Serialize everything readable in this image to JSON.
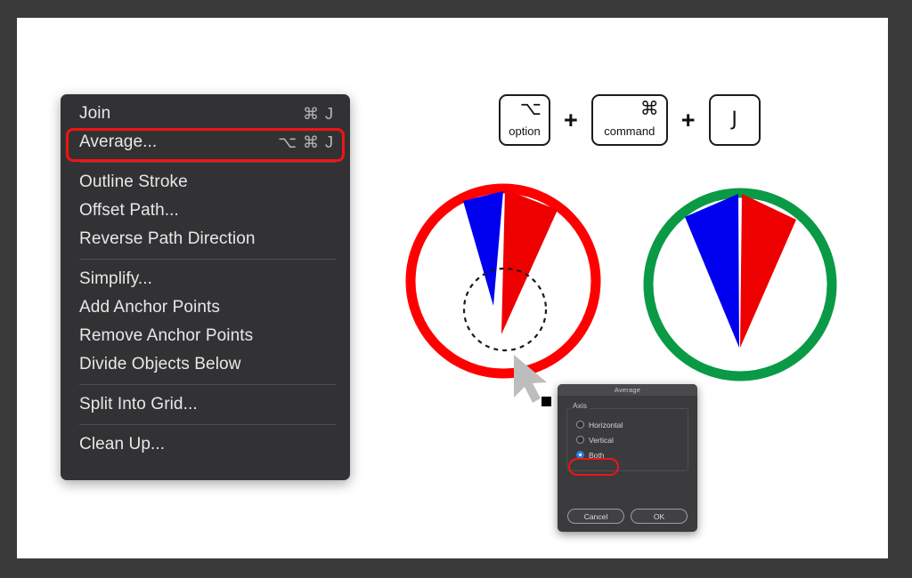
{
  "app": {
    "title": "Illustrator Average Path Tip",
    "canvas_background": "#ffffff",
    "frame_color": "#3a3a3a"
  },
  "context_menu": {
    "name": "Path context menu",
    "background": "#323234",
    "highlighted_item": "Average...",
    "highlight_color": "#f01414",
    "items": [
      {
        "label": "Join",
        "shortcut": "⌘ J",
        "highlighted": false
      },
      {
        "label": "Average...",
        "shortcut": "⌥ ⌘ J",
        "highlighted": true
      },
      {
        "label": "Outline Stroke",
        "shortcut": "",
        "highlighted": false
      },
      {
        "label": "Offset Path...",
        "shortcut": "",
        "highlighted": false
      },
      {
        "label": "Reverse Path Direction",
        "shortcut": "",
        "highlighted": false
      },
      {
        "label": "Simplify...",
        "shortcut": "",
        "highlighted": false
      },
      {
        "label": "Add Anchor Points",
        "shortcut": "",
        "highlighted": false
      },
      {
        "label": "Remove Anchor Points",
        "shortcut": "",
        "highlighted": false
      },
      {
        "label": "Divide Objects Below",
        "shortcut": "",
        "highlighted": false
      },
      {
        "label": "Split Into Grid...",
        "shortcut": "",
        "highlighted": false
      },
      {
        "label": "Clean Up...",
        "shortcut": "",
        "highlighted": false
      }
    ]
  },
  "shortcut_keys": {
    "separator": "+",
    "keys": [
      {
        "glyph": "⌥",
        "name": "option"
      },
      {
        "glyph": "⌘",
        "name": "command"
      },
      {
        "glyph": "J",
        "name": ""
      }
    ]
  },
  "artwork": {
    "before": {
      "caption": "",
      "circle_stroke_color": "#ff0000",
      "wedges": [
        {
          "color": "#0000ee",
          "label": "blue-wedge"
        },
        {
          "color": "#ee0000",
          "label": "red-wedge"
        }
      ],
      "selection_marquee": "dashed-circle",
      "cursor": "arrow-cursor",
      "anchor_point": "black-square"
    },
    "after": {
      "caption": "",
      "circle_stroke_color": "#0a9a46",
      "wedges": [
        {
          "color": "#0000ee",
          "label": "blue-wedge"
        },
        {
          "color": "#ee0000",
          "label": "red-wedge"
        }
      ]
    }
  },
  "dialog": {
    "title": "Average",
    "group_label": "Axis",
    "options": [
      {
        "label": "Horizontal",
        "selected": false
      },
      {
        "label": "Vertical",
        "selected": false
      },
      {
        "label": "Both",
        "selected": true
      }
    ],
    "highlighted_option": "Both",
    "highlight_color": "#f01414",
    "buttons": [
      {
        "label": "Cancel"
      },
      {
        "label": "OK"
      }
    ]
  }
}
